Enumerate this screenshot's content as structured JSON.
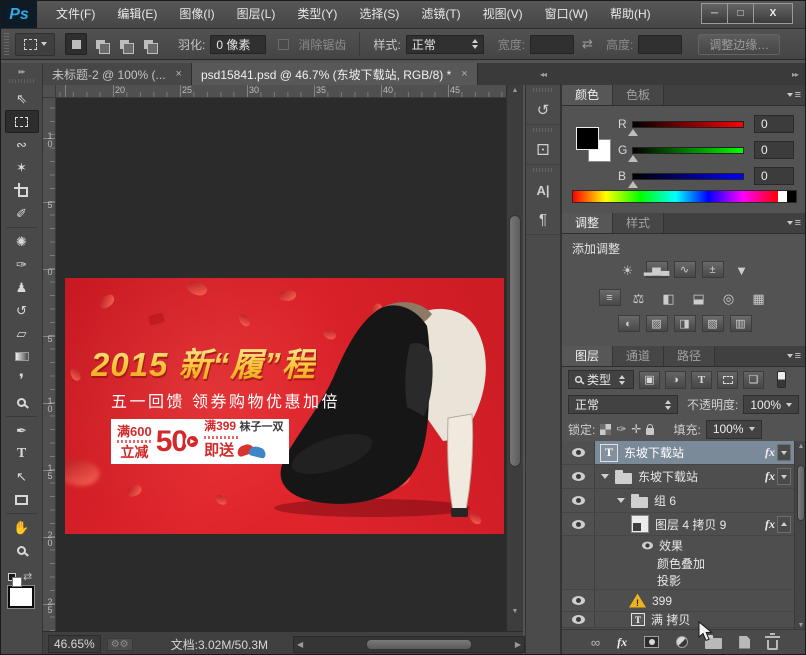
{
  "titlebar": {
    "logo": "Ps",
    "menus": [
      "文件(F)",
      "编辑(E)",
      "图像(I)",
      "图层(L)",
      "类型(Y)",
      "选择(S)",
      "滤镜(T)",
      "视图(V)",
      "窗口(W)",
      "帮助(H)"
    ],
    "minimize": "─",
    "maximize": "□",
    "close": "X"
  },
  "options": {
    "feather_label": "羽化:",
    "feather_value": "0 像素",
    "antialias_label": "消除锯齿",
    "style_label": "样式:",
    "style_value": "正常",
    "width_label": "宽度:",
    "width_value": "",
    "height_label": "高度:",
    "height_value": "",
    "refine_edge_label": "调整边缘…"
  },
  "tabbar": {
    "tab1": "未标题-2 @ 100% (...",
    "tab2": "psd15841.psd @ 46.7% (东坡下载站, RGB/8) *",
    "close": "×"
  },
  "ruler": {
    "h": [
      "20",
      "25",
      "30",
      "35",
      "40",
      "45"
    ],
    "v": [
      "10",
      "5",
      "0",
      "5",
      "10",
      "15",
      "20",
      "25"
    ]
  },
  "banner": {
    "title": "2015 新“履”程",
    "subtitle": "五一回馈  领券购物优惠加倍",
    "coupon1_top": "满600",
    "coupon1_bottom": "立减",
    "coupon1_big": "50",
    "coupon2_top": "满399",
    "coupon2_top2": "袜子一双",
    "coupon2_bottom": "即送",
    "circle_arrow": "▶"
  },
  "status": {
    "zoom": "46.65%",
    "doc": "文档:3.02M/50.3M"
  },
  "color_panel": {
    "tab_color": "颜色",
    "tab_swatches": "色板",
    "r_label": "R",
    "g_label": "G",
    "b_label": "B",
    "r_value": "0",
    "g_value": "0",
    "b_value": "0"
  },
  "adjust_panel": {
    "tab_adjust": "调整",
    "tab_style": "样式",
    "add_label": "添加调整"
  },
  "layers_panel": {
    "tab_layers": "图层",
    "tab_channels": "通道",
    "tab_paths": "路径",
    "filter_type": "类型",
    "blend_mode": "正常",
    "opacity_label": "不透明度:",
    "opacity_value": "100%",
    "lock_label": "锁定:",
    "fill_label": "填充:",
    "fill_value": "100%",
    "fx_label": "fx",
    "char_icon_T": "T",
    "rows": [
      {
        "name": "东坡下载站"
      },
      {
        "name": "东坡下载站"
      },
      {
        "name": "组 6"
      },
      {
        "name": "图层 4 拷贝 9"
      },
      {
        "name": "效果"
      },
      {
        "name": "颜色叠加"
      },
      {
        "name": "投影"
      },
      {
        "name": "399"
      },
      {
        "name": "满 拷贝"
      }
    ],
    "warn_mark": "!"
  },
  "collapsed_icons": {
    "char_panel": "A|",
    "para_panel": "¶"
  }
}
